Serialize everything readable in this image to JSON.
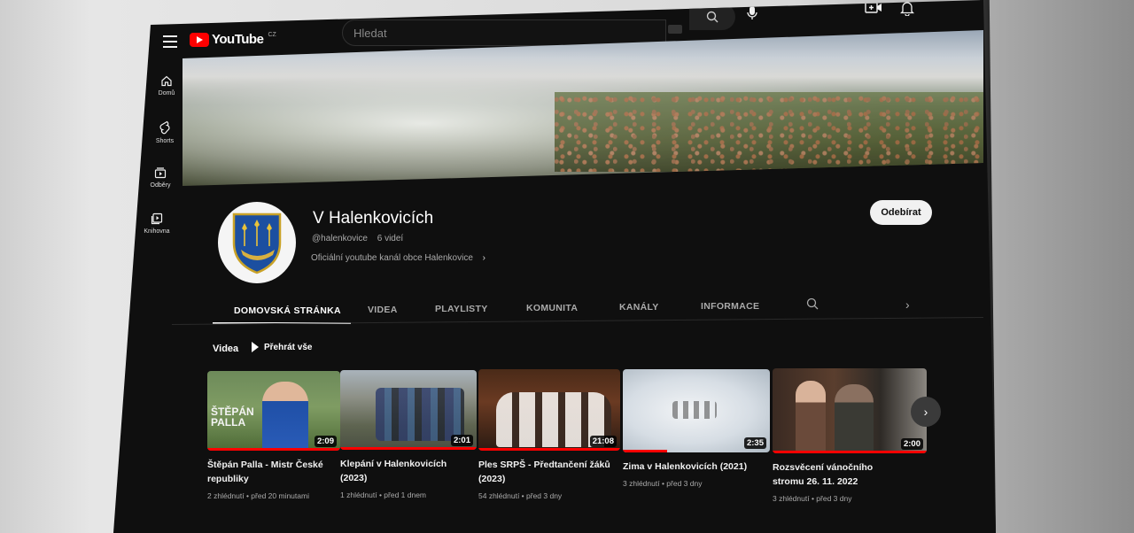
{
  "header": {
    "logo_text": "YouTube",
    "country_code": "CZ",
    "search_placeholder": "Hledat"
  },
  "sidebar": {
    "items": [
      {
        "label": "Domů",
        "icon": "home-icon"
      },
      {
        "label": "Shorts",
        "icon": "shorts-icon"
      },
      {
        "label": "Odběry",
        "icon": "subscriptions-icon"
      },
      {
        "label": "Knihovna",
        "icon": "library-icon"
      }
    ]
  },
  "channel": {
    "name": "V Halenkovicích",
    "handle": "@halenkovice",
    "video_count": "6 videí",
    "description": "Oficiální youtube kanál obce Halenkovice",
    "subscribe_label": "Odebírat"
  },
  "tabs": [
    {
      "label": "DOMOVSKÁ STRÁNKA",
      "active": true
    },
    {
      "label": "VIDEA",
      "active": false
    },
    {
      "label": "PLAYLISTY",
      "active": false
    },
    {
      "label": "KOMUNITA",
      "active": false
    },
    {
      "label": "KANÁLY",
      "active": false
    },
    {
      "label": "INFORMACE",
      "active": false
    }
  ],
  "section": {
    "title": "Videa",
    "play_all": "Přehrát vše"
  },
  "videos": [
    {
      "title_line1": "Štěpán Palla - Mistr České",
      "title_line2": "republiky",
      "duration": "2:09",
      "meta": "2 zhlédnutí • před 20 minutami",
      "overlay_text": "ŠTĚPÁN PALLA",
      "progress": 1.0
    },
    {
      "title_line1": "Klepání v Halenkovicích",
      "title_line2": "(2023)",
      "duration": "2:01",
      "meta": "1 zhlédnutí • před 1 dnem",
      "progress": 1.0
    },
    {
      "title_line1": "Ples SRPŠ - Předtančení žáků",
      "title_line2": "(2023)",
      "duration": "21:08",
      "meta": "54 zhlédnutí • před 3 dny",
      "progress": 1.0
    },
    {
      "title_line1": "Zima v Halenkovicích (2021)",
      "title_line2": "",
      "duration": "2:35",
      "meta": "3 zhlédnutí • před 3 dny",
      "progress": 0.3
    },
    {
      "title_line1": "Rozsvěcení vánočního",
      "title_line2": "stromu 26. 11. 2022",
      "duration": "2:00",
      "meta": "3 zhlédnutí • před 3 dny",
      "progress": 1.0
    }
  ],
  "colors": {
    "background": "#0f0f0f",
    "accent": "#ff0000",
    "text": "#f1f1f1",
    "secondary_text": "#aaaaaa"
  }
}
